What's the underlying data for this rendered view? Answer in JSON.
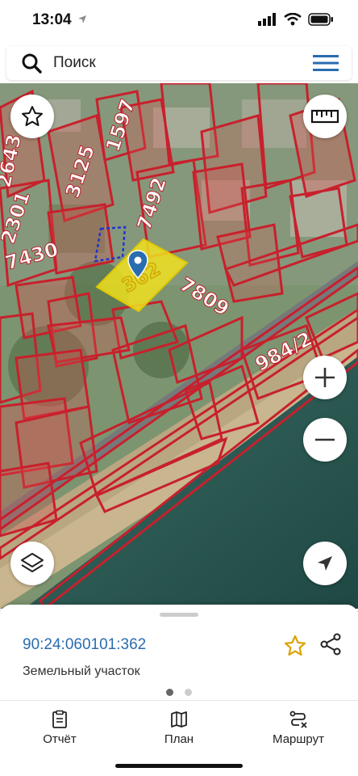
{
  "status": {
    "time": "13:04"
  },
  "search": {
    "placeholder": "Поиск"
  },
  "map": {
    "parcel_labels": [
      "2643",
      "1597",
      "3125",
      "2301",
      "7492",
      "7430",
      "7809",
      "984/2"
    ],
    "selected_parcel_label": "362"
  },
  "sheet": {
    "cadastral_number": "90:24:060101:362",
    "type": "Земельный участок",
    "page_count": 2,
    "active_page": 1
  },
  "tabs": [
    {
      "label": "Отчёт",
      "icon": "report-icon"
    },
    {
      "label": "План",
      "icon": "map-plan-icon"
    },
    {
      "label": "Маршрут",
      "icon": "route-icon"
    }
  ],
  "colors": {
    "accent": "#2a6cb0",
    "parcel_border": "#c8202c",
    "selected_parcel": "#f0e020",
    "sea": "#2d5a55"
  }
}
